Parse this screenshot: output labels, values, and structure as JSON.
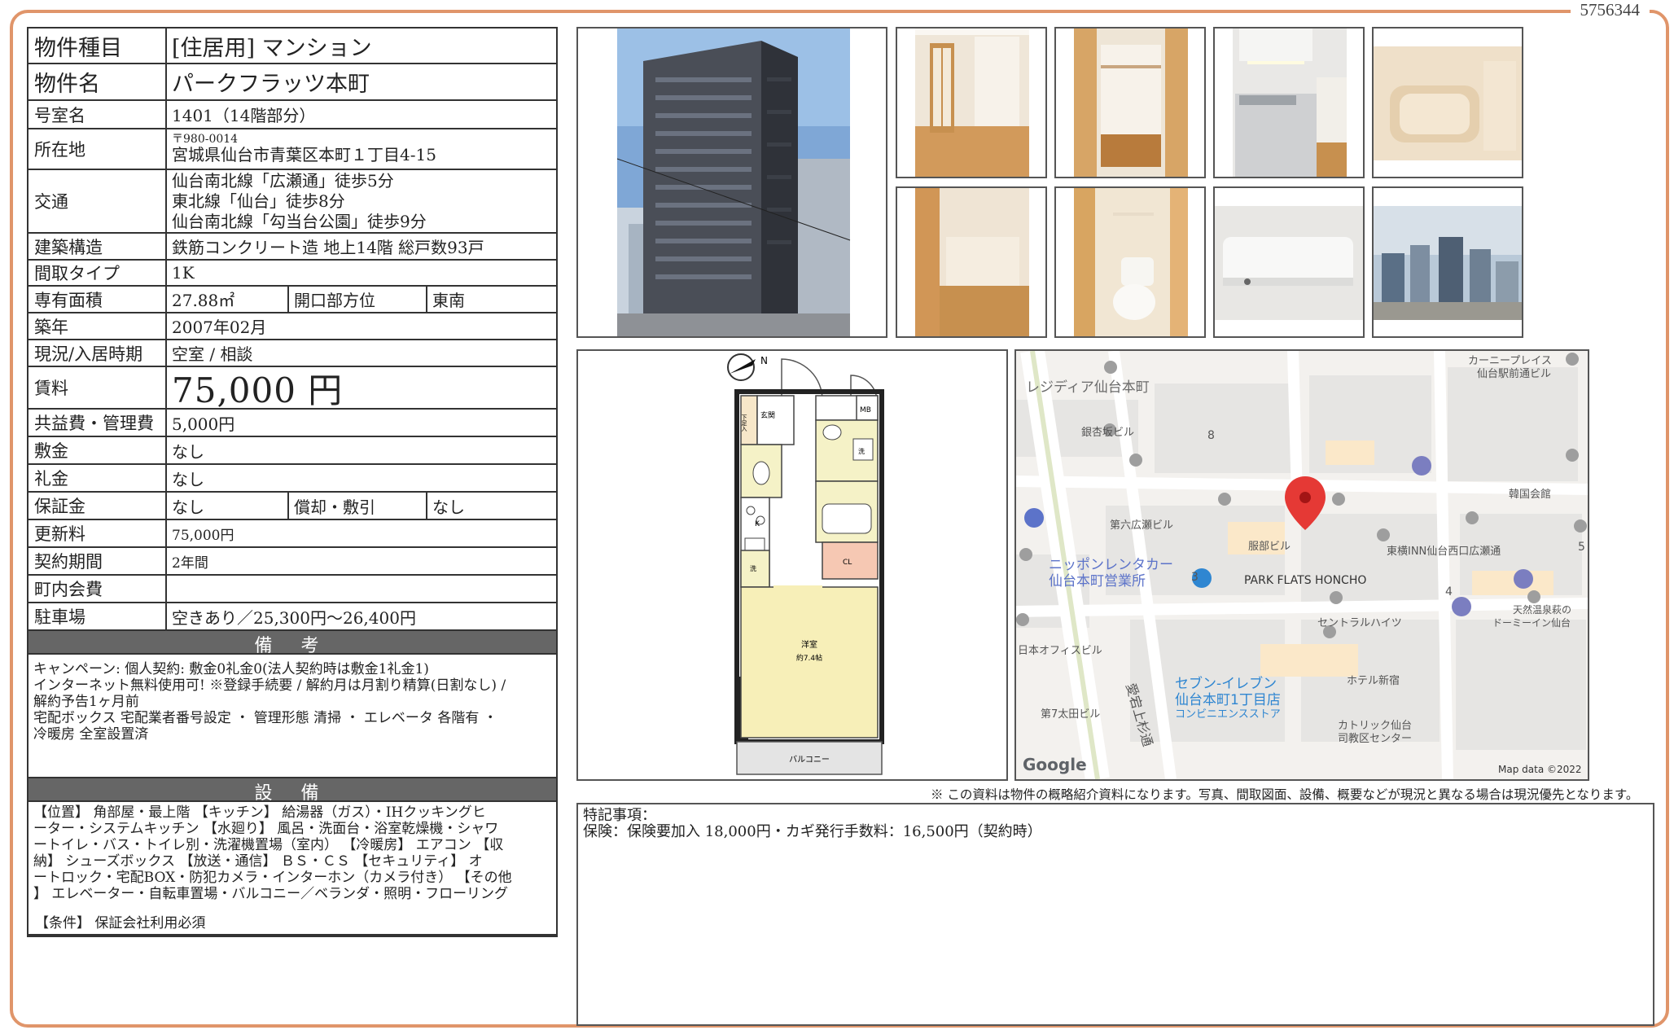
{
  "doc_id": "5756344",
  "property": {
    "type_label": "物件種目",
    "type_value": "[住居用]  マンション",
    "name_label": "物件名",
    "name_value": "パークフラッツ本町",
    "room_label": "号室名",
    "room_value": "1401（14階部分）",
    "address_label": "所在地",
    "postal": "〒980-0014",
    "address_value": "宮城県仙台市青葉区本町１丁目4-15",
    "access_label": "交通",
    "access_lines": [
      "仙台南北線「広瀬通」徒歩5分",
      "東北線「仙台」徒歩8分",
      "仙台南北線「勾当台公園」徒歩9分"
    ],
    "structure_label": "建築構造",
    "structure_value": "鉄筋コンクリート造 地上14階 総戸数93戸",
    "layout_label": "間取タイプ",
    "layout_value": "1K",
    "area_label": "専有面積",
    "area_value": "27.88㎡",
    "direction_label": "開口部方位",
    "direction_value": "東南",
    "built_label": "築年",
    "built_value": "2007年02月",
    "status_label": "現況/入居時期",
    "status_value": "空室 / 相談",
    "rent_label": "賃料",
    "rent_value": "75,000 円",
    "fee_label": "共益費・管理費",
    "fee_value": "5,000円",
    "deposit_label": "敷金",
    "deposit_value": "なし",
    "key_money_label": "礼金",
    "key_money_value": "なし",
    "guarantee_label": "保証金",
    "guarantee_value": "なし",
    "amort_label": "償却・敷引",
    "amort_value": "なし",
    "renewal_label": "更新料",
    "renewal_value": "75,000円",
    "contract_label": "契約期間",
    "contract_value": "2年間",
    "town_fee_label": "町内会費",
    "town_fee_value": "",
    "parking_label": "駐車場",
    "parking_value": "空きあり／25,300円〜26,400円"
  },
  "remarks": {
    "title": "備 考",
    "lines": [
      "キャンペーン: 個人契約: 敷金0礼金0(法人契約時は敷金1礼金1)",
      "インターネット無料使用可! ※登録手続要 / 解約月は月割り精算(日割なし) /",
      "解約予告1ヶ月前",
      "宅配ボックス 宅配業者番号設定 ・ 管理形態 清掃 ・ エレベータ 各階有 ・",
      "冷暖房 全室設置済"
    ]
  },
  "equipment": {
    "title": "設 備",
    "lines": [
      "【位置】 角部屋・最上階 【キッチン】 給湯器（ガス）・IHクッキングヒ",
      "ーター・システムキッチン 【水廻り】 風呂・洗面台・浴室乾燥機・シャワ",
      "ートイレ・バス・トイレ別・洗濯機置場（室内） 【冷暖房】 エアコン 【収",
      "納】 シューズボックス 【放送・通信】 ＢＳ・ＣＳ 【セキュリティ】 オ",
      "ートロック・宅配BOX・防犯カメラ・インターホン（カメラ付き） 【その他",
      "】 エレベーター・自転車置場・バルコニー／ベランダ・照明・フローリング"
    ]
  },
  "conditions": {
    "title": "条 件",
    "line": "【条件】 保証会社利用必須"
  },
  "floorplan": {
    "genkan": "玄関",
    "shoes": "下足入",
    "mb": "MB",
    "sen": "洗",
    "k": "K",
    "cl": "CL",
    "room": "洋室",
    "room_size": "約7.4帖",
    "balcony": "バルコニー"
  },
  "map": {
    "labels": [
      "レジディア仙台本町",
      "銀杏坂ビル",
      "8",
      "第六広瀬ビル",
      "服部ビル",
      "PARK FLATS HONCHO",
      "東横INN仙台西口広瀬通",
      "ニッポンレンタカー",
      "仙台本町営業所",
      "3",
      "4",
      "5",
      "セントラルハイツ",
      "日本オフィスビル",
      "セブン-イレブン",
      "仙台本町1丁目店",
      "コンビニエンスストア",
      "ホテル新宿",
      "第7太田ビル",
      "愛宕上杉通",
      "カトリック仙台",
      "司教区センター",
      "カーニープレイス",
      "仙台駅前通ビル",
      "韓国会館",
      "天然温泉萩の",
      "ドーミーイン仙台",
      "Google",
      "Map data ©2022"
    ]
  },
  "disclaimer": "※ この資料は物件の概略紹介資料になります。写真、間取図面、設備、概要などが現況と異なる場合は現況優先となります。",
  "special": {
    "title": "特記事項：",
    "line": "保険：保険要加入 18,000円・カギ発行手数料：16,500円（契約時）"
  }
}
